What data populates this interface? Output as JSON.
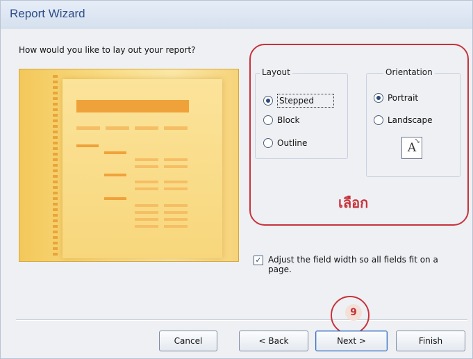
{
  "window": {
    "title": "Report Wizard"
  },
  "prompt": "How would you like to lay out your report?",
  "layout": {
    "title": "Layout",
    "options": [
      "Stepped",
      "Block",
      "Outline"
    ],
    "selected": "Stepped"
  },
  "orientation": {
    "title": "Orientation",
    "options": [
      "Portrait",
      "Landscape"
    ],
    "selected": "Portrait",
    "icon_letter": "A"
  },
  "annotation": {
    "note": "เลือก",
    "step": "9"
  },
  "adjust": {
    "checked": true,
    "label": "Adjust the field width so all fields fit on a page."
  },
  "buttons": {
    "cancel": "Cancel",
    "back": "< Back",
    "next": "Next >",
    "finish": "Finish"
  },
  "colors": {
    "annotation_red": "#c8323a",
    "title_blue": "#2f4f8a",
    "preview_orange": "#f0a23a"
  }
}
